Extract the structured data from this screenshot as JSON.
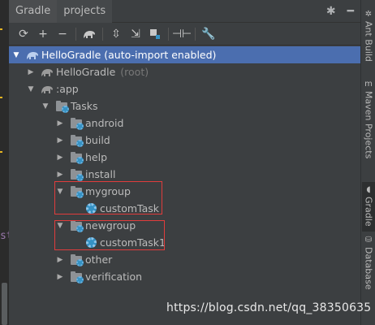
{
  "colors": {
    "selection": "#4b6eaf",
    "panel_bg": "#3c3f41",
    "highlight_box": "#e03c3c",
    "gradle_icon_blue": "#3592c4"
  },
  "editor_strip": {
    "ghost_text": "st"
  },
  "tabs": [
    {
      "label": "Gradle",
      "active": true
    },
    {
      "label": "projects",
      "active": false
    }
  ],
  "tabbar_icons": {
    "settings": "gear-icon",
    "minimize": "minimize-icon"
  },
  "toolbar": [
    "refresh-icon",
    "add-icon",
    "remove-icon",
    "elephant-run-icon",
    "expand-all-icon",
    "collapse-all-icon",
    "link-icon",
    "toggle-offline-icon",
    "wrench-icon"
  ],
  "tree": {
    "root": {
      "label": "HelloGradle (auto-import enabled)"
    },
    "hello_gradle": {
      "label": "HelloGradle",
      "suffix": "(root)"
    },
    "app": {
      "label": ":app"
    },
    "tasks": {
      "label": "Tasks"
    },
    "groups": [
      {
        "label": "android"
      },
      {
        "label": "build"
      },
      {
        "label": "help"
      },
      {
        "label": "install"
      },
      {
        "label": "mygroup",
        "child": "customTask"
      },
      {
        "label": "newgroup",
        "child": "customTask1"
      },
      {
        "label": "other"
      },
      {
        "label": "verification"
      }
    ]
  },
  "side_tabs": [
    {
      "label": "Ant Build"
    },
    {
      "label": "Maven Projects"
    },
    {
      "label": "Gradle"
    },
    {
      "label": "Database"
    }
  ],
  "watermark": "https://blog.csdn.net/qq_38350635"
}
